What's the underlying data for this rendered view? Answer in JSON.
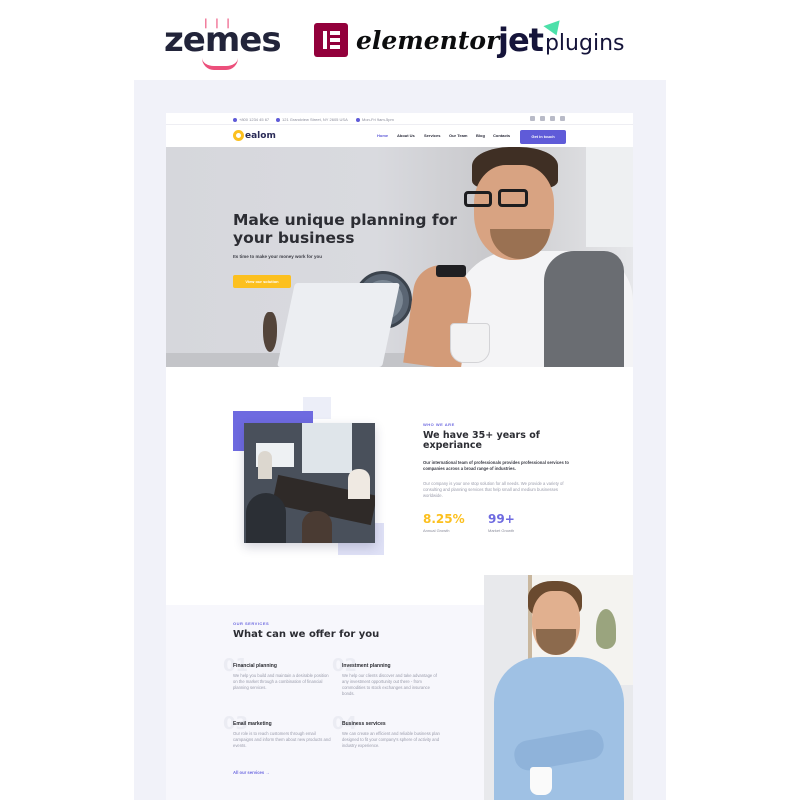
{
  "brands": {
    "zemes": "zemes",
    "elementor": "elementor",
    "jet": "jet",
    "plugins": "plugins"
  },
  "topbar": {
    "phone": "+800 1234 45 67",
    "address": "121 Grandview Street, NY 2605 USA",
    "hours": "Mon-Fri 9am-5pm"
  },
  "nav": {
    "logo": "ealom",
    "items": [
      "Home",
      "About Us",
      "Services",
      "Our Team",
      "Blog",
      "Contacts"
    ],
    "cta": "Get in touch"
  },
  "hero": {
    "title": "Make unique planning for your business",
    "subtitle": "Its time to make your money work for you",
    "button": "View our solution"
  },
  "about": {
    "eyebrow": "WHO WE ARE",
    "title": "We have 35+ years of experiance",
    "lead": "Our international team of professionals provides professional services to companies across a broad range of industries.",
    "body": "Our company is your one stop solution for all needs. We provide a variety of consulting and planning services that help small and medium businesses worldwide.",
    "stats": [
      {
        "value": "8.25%",
        "label": "Annual Growth",
        "color": "#fcc01f"
      },
      {
        "value": "99+",
        "label": "Market Growth",
        "color": "#6e6ae0"
      }
    ]
  },
  "services": {
    "eyebrow": "OUR SERVICES",
    "title": "What can we offer for you",
    "items": [
      {
        "num": "01",
        "title": "Financial planning",
        "desc": "We help you build and maintain a desirable position on the market through a combination of financial planning services."
      },
      {
        "num": "02",
        "title": "Investment planning",
        "desc": "We help our clients discover and take advantage of any investment opportunity out there - from commodities to stock exchanges and insurance bonds."
      },
      {
        "num": "03",
        "title": "Email marketing",
        "desc": "Our role is to reach customers through email campaigns and inform them about new products and events."
      },
      {
        "num": "04",
        "title": "Business services",
        "desc": "We can create an efficient and reliable business plan designed to fit your company's sphere of activity and industry experience."
      }
    ],
    "all_link": "All our services"
  },
  "icons": {
    "phone": "phone-icon",
    "location": "location-icon",
    "clock": "clock-icon",
    "arrow": "→"
  },
  "colors": {
    "accent": "#5f5bd8",
    "yellow": "#fcc01f"
  }
}
